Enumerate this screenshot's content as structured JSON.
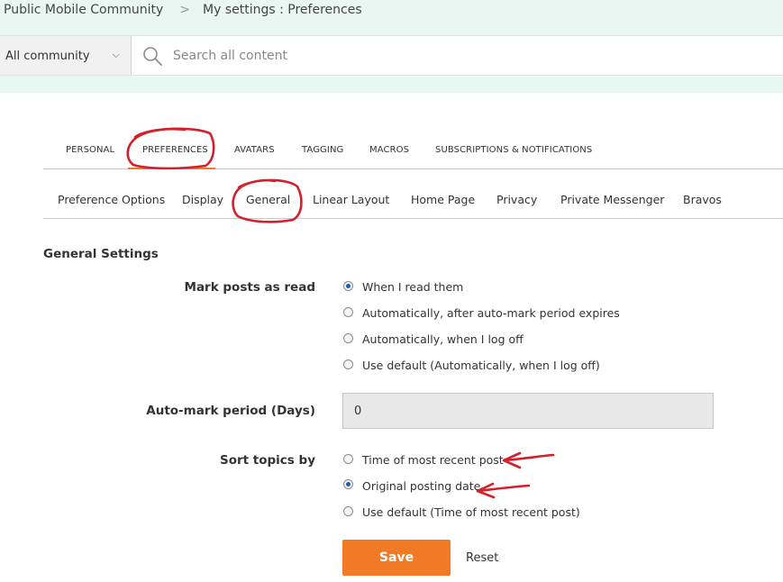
{
  "breadcrumb": {
    "home": "Public Mobile Community",
    "separator": ">",
    "current": "My settings : Preferences"
  },
  "search": {
    "scope": "All community",
    "placeholder": "Search all content"
  },
  "main_tabs": [
    "PERSONAL",
    "PREFERENCES",
    "AVATARS",
    "TAGGING",
    "MACROS",
    "SUBSCRIPTIONS & NOTIFICATIONS"
  ],
  "main_tabs_active": "PREFERENCES",
  "sub_tabs": [
    "Preference Options",
    "Display",
    "General",
    "Linear Layout",
    "Home Page",
    "Privacy",
    "Private Messenger",
    "Bravos"
  ],
  "sub_tabs_active": "General",
  "section_title": "General Settings",
  "mark_read": {
    "label": "Mark posts as read",
    "options": [
      "When I read them",
      "Automatically, after auto-mark period expires",
      "Automatically, when I log off",
      "Use default (Automatically, when I log off)"
    ],
    "selected": "When I read them"
  },
  "auto_mark": {
    "label": "Auto-mark period (Days)",
    "value": "0"
  },
  "sort_topics": {
    "label": "Sort topics by",
    "options": [
      "Time of most recent post",
      "Original posting date",
      "Use default (Time of most recent post)"
    ],
    "selected": "Original posting date"
  },
  "actions": {
    "save": "Save",
    "reset": "Reset"
  },
  "colors": {
    "accent": "#f07a26",
    "header_bg": "#e9f7f3",
    "radio_selected": "#1a5fb4",
    "annotation": "#d3202a"
  },
  "icons": [
    "search-icon",
    "chevron-down-icon"
  ]
}
